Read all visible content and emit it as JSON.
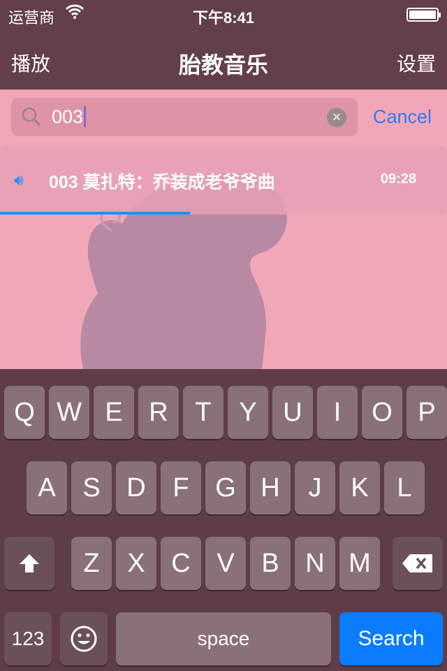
{
  "status": {
    "carrier": "运营商",
    "time": "下午8:41",
    "battery_level": 1.0
  },
  "nav": {
    "left": "播放",
    "title": "胎教音乐",
    "right": "设置"
  },
  "search": {
    "value": "003",
    "cancel": "Cancel"
  },
  "result": {
    "name": "003 莫扎特：乔装成老爷爷曲",
    "duration": "09:28",
    "progress": 0.425
  },
  "keyboard": {
    "row1": [
      "Q",
      "W",
      "E",
      "R",
      "T",
      "Y",
      "U",
      "I",
      "O",
      "P"
    ],
    "row2": [
      "A",
      "S",
      "D",
      "F",
      "G",
      "H",
      "J",
      "K",
      "L"
    ],
    "row3": [
      "Z",
      "X",
      "C",
      "V",
      "B",
      "N",
      "M"
    ],
    "numbers": "123",
    "space": "space",
    "search": "Search"
  },
  "colors": {
    "bar": "#623f4a",
    "accent": "#1e90ff",
    "background": "#f2a7b9",
    "search_key": "#0a7cff"
  }
}
